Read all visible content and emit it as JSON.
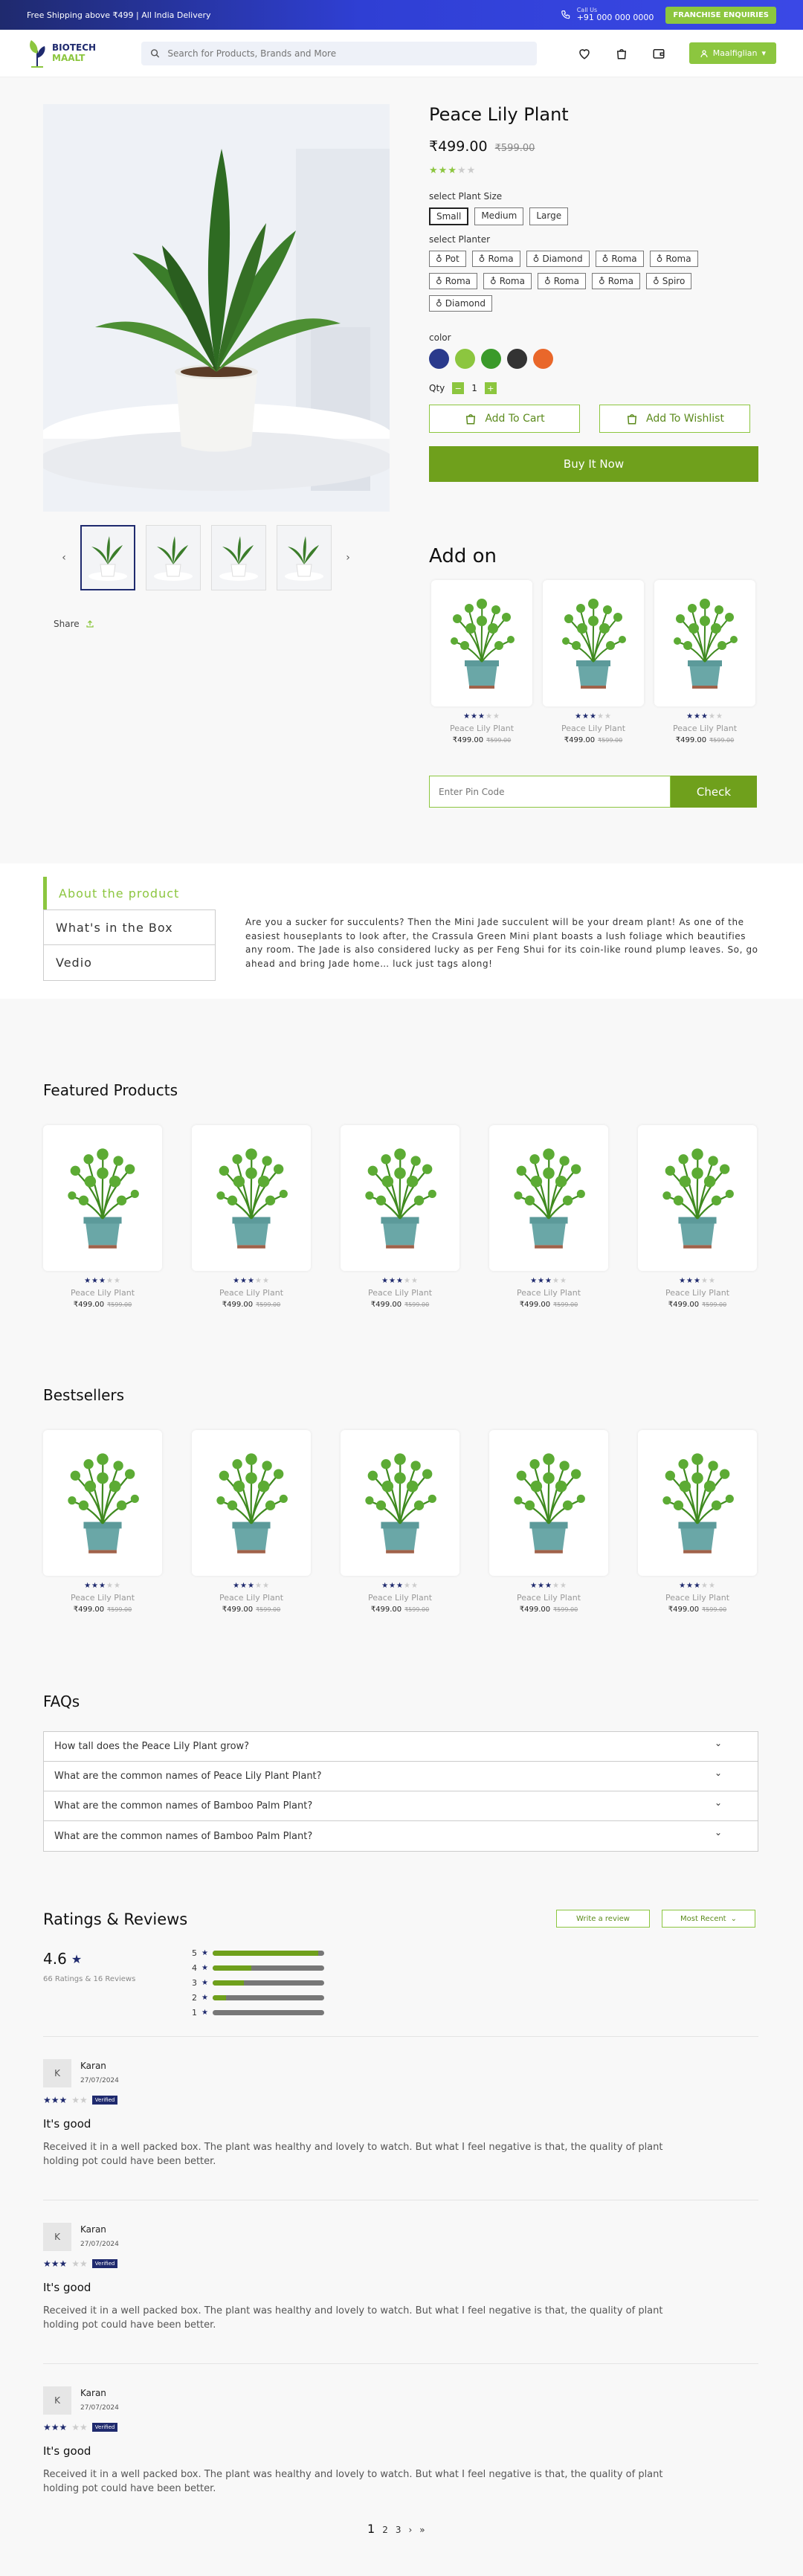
{
  "topbar": {
    "shipping": "Free Shipping above ₹499 | All India Delivery",
    "call_label": "Call Us",
    "phone": "+91 000 000 0000",
    "franchise": "FRANCHISE ENQUIRIES"
  },
  "header": {
    "logo_line1": "BIOTECH",
    "logo_line2": "MAALT",
    "search_placeholder": "Search for Products, Brands and More",
    "user": "Maalfiglian"
  },
  "product": {
    "title": "Peace Lily Plant",
    "price": "₹499.00",
    "old_price": "₹599.00",
    "rating": 3,
    "size_label": "select Plant Size",
    "sizes": [
      "Small",
      "Medium",
      "Large"
    ],
    "planter_label": "select Planter",
    "planters": [
      "Pot",
      "Roma",
      "Diamond",
      "Roma",
      "Roma",
      "Roma",
      "Roma",
      "Roma",
      "Roma",
      "Spiro",
      "Diamond"
    ],
    "color_label": "color",
    "colors": [
      "#2a3a8c",
      "#8cc63f",
      "#3a9a2a",
      "#333333",
      "#e9672a"
    ],
    "qty_label": "Qty",
    "qty": "1",
    "qty_minus": "−",
    "qty_plus": "+",
    "add_to_cart": "Add To Cart",
    "add_to_wishlist": "Add To Wishlist",
    "buy_now": "Buy It Now",
    "share": "Share",
    "prev": "‹",
    "next": "›"
  },
  "addon": {
    "title": "Add on",
    "items": [
      {
        "name": "Peace Lily Plant",
        "price": "₹499.00",
        "old": "₹599.00",
        "rating": 3
      },
      {
        "name": "Peace Lily Plant",
        "price": "₹499.00",
        "old": "₹599.00",
        "rating": 3
      },
      {
        "name": "Peace Lily Plant",
        "price": "₹499.00",
        "old": "₹599.00",
        "rating": 3
      }
    ]
  },
  "pincode": {
    "placeholder": "Enter Pin Code",
    "button": "Check"
  },
  "about": {
    "tabs": [
      "About the product",
      "What's in the Box",
      "Vedio"
    ],
    "text": "Are you a sucker for succulents? Then the Mini Jade succulent will be your dream plant! As one of the easiest houseplants to look after, the Crassula Green Mini plant boasts a lush foliage which beautifies any room. The Jade is also considered lucky as per Feng Shui for its coin-like round plump leaves. So, go ahead and bring Jade home… luck just tags along!"
  },
  "featured": {
    "title": "Featured Products",
    "items": [
      {
        "name": "Peace Lily Plant",
        "price": "₹499.00",
        "old": "₹599.00",
        "rating": 3
      },
      {
        "name": "Peace Lily Plant",
        "price": "₹499.00",
        "old": "₹599.00",
        "rating": 3
      },
      {
        "name": "Peace Lily Plant",
        "price": "₹499.00",
        "old": "₹599.00",
        "rating": 3
      },
      {
        "name": "Peace Lily Plant",
        "price": "₹499.00",
        "old": "₹599.00",
        "rating": 3
      },
      {
        "name": "Peace Lily Plant",
        "price": "₹499.00",
        "old": "₹599.00",
        "rating": 3
      }
    ]
  },
  "bestsellers": {
    "title": "Bestsellers",
    "items": [
      {
        "name": "Peace Lily Plant",
        "price": "₹499.00",
        "old": "₹599.00",
        "rating": 3
      },
      {
        "name": "Peace Lily Plant",
        "price": "₹499.00",
        "old": "₹599.00",
        "rating": 3
      },
      {
        "name": "Peace Lily Plant",
        "price": "₹499.00",
        "old": "₹599.00",
        "rating": 3
      },
      {
        "name": "Peace Lily Plant",
        "price": "₹499.00",
        "old": "₹599.00",
        "rating": 3
      },
      {
        "name": "Peace Lily Plant",
        "price": "₹499.00",
        "old": "₹599.00",
        "rating": 3
      }
    ]
  },
  "faq": {
    "title": "FAQs",
    "items": [
      "How tall does the Peace Lily Plant grow?",
      "What are the common names of Peace Lily Plant Plant?",
      "What are the common names of Bamboo Palm Plant?",
      "What are the common names of Bamboo Palm Plant?"
    ]
  },
  "reviews": {
    "title": "Ratings & Reviews",
    "write": "Write a review",
    "sort": "Most Recent",
    "average": "4.6",
    "summary": "66 Ratings & 16 Reviews",
    "distribution": [
      {
        "star": "5",
        "level": 0.95
      },
      {
        "star": "4",
        "level": 0.35
      },
      {
        "star": "3",
        "level": 0.28
      },
      {
        "star": "2",
        "level": 0.12
      },
      {
        "star": "1",
        "level": 0
      }
    ],
    "items": [
      {
        "initial": "K",
        "name": "Karan",
        "date": "27/07/2024",
        "rating": 3,
        "badge": "Verified",
        "title": "It's good",
        "text": "Received it in a well packed box. The plant was healthy and lovely to watch. But what I feel negative is that, the quality of plant holding pot could have been better."
      },
      {
        "initial": "K",
        "name": "Karan",
        "date": "27/07/2024",
        "rating": 3,
        "badge": "Verified",
        "title": "It's good",
        "text": "Received it in a well packed box. The plant was healthy and lovely to watch. But what I feel negative is that, the quality of plant holding pot could have been better."
      },
      {
        "initial": "K",
        "name": "Karan",
        "date": "27/07/2024",
        "rating": 3,
        "badge": "Verified",
        "title": "It's good",
        "text": "Received it in a well packed box. The plant was healthy and lovely to watch. But what I feel negative is that, the quality of plant holding pot could have been better."
      }
    ]
  },
  "pagination": {
    "pages": [
      "1",
      "2",
      "3"
    ],
    "next": "›",
    "last": "»"
  }
}
